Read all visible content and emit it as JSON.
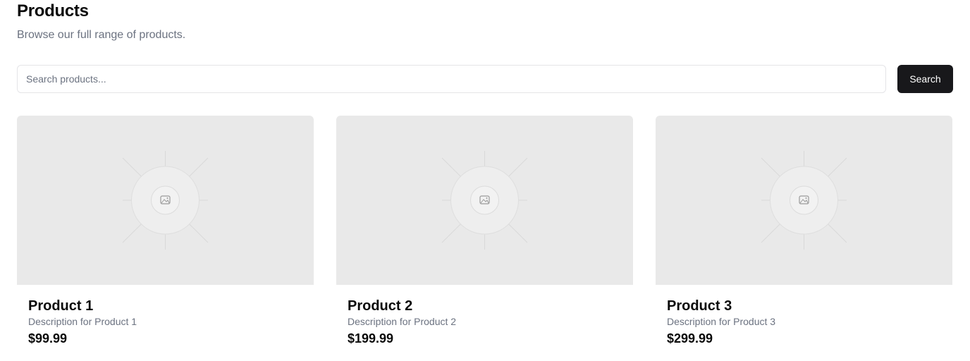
{
  "header": {
    "title": "Products",
    "subtitle": "Browse our full range of products."
  },
  "search": {
    "placeholder": "Search products...",
    "value": "",
    "button_label": "Search"
  },
  "products": [
    {
      "name": "Product 1",
      "description": "Description for Product 1",
      "price": "$99.99",
      "image_icon": "image-placeholder-icon"
    },
    {
      "name": "Product 2",
      "description": "Description for Product 2",
      "price": "$199.99",
      "image_icon": "image-placeholder-icon"
    },
    {
      "name": "Product 3",
      "description": "Description for Product 3",
      "price": "$299.99",
      "image_icon": "image-placeholder-icon"
    }
  ],
  "colors": {
    "button_bg": "#18181b",
    "muted_text": "#6b7280",
    "image_bg": "#e9e9e9",
    "border": "#e4e4e7"
  }
}
